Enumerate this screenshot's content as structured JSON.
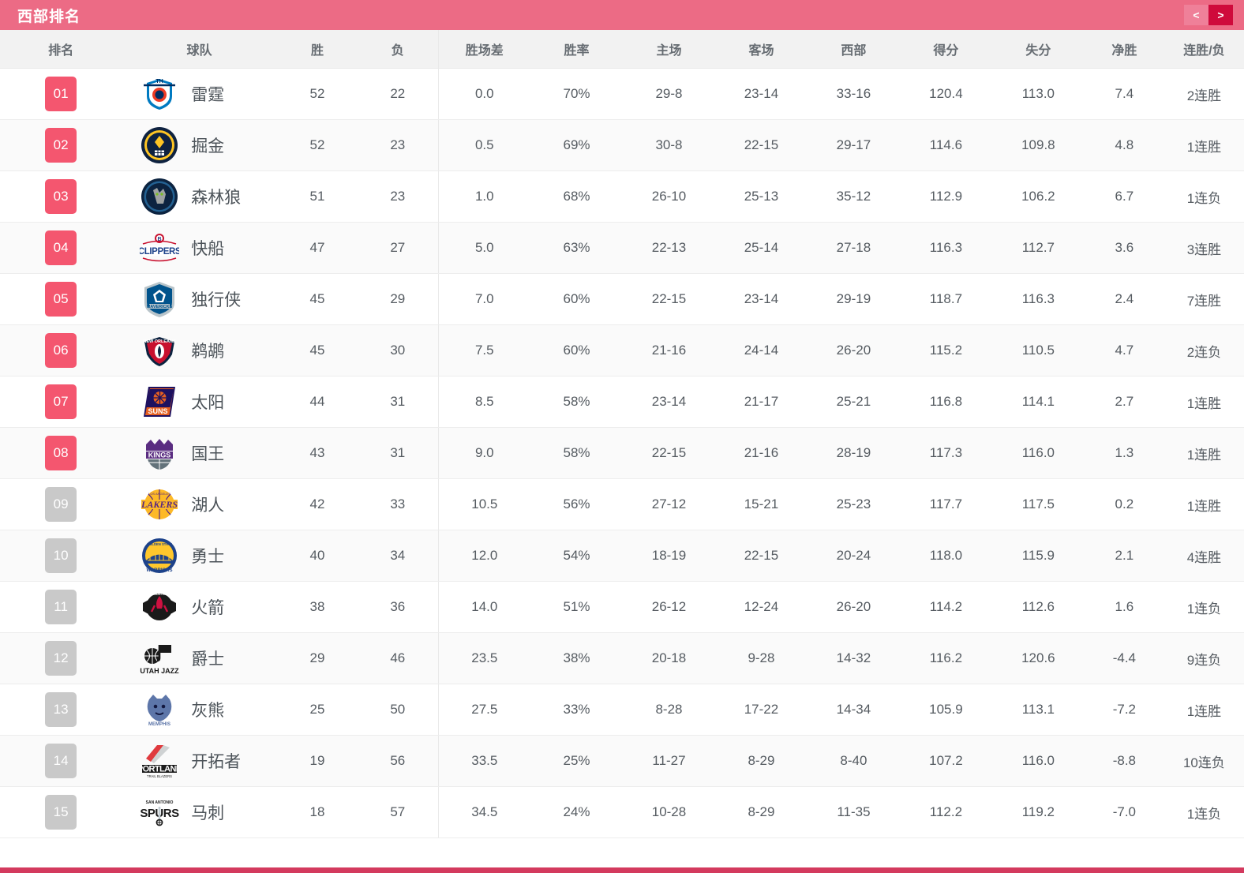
{
  "header": {
    "title": "西部排名",
    "prev_label": "<",
    "next_label": ">"
  },
  "table": {
    "columns": [
      "排名",
      "球队",
      "胜",
      "负",
      "胜场差",
      "胜率",
      "主场",
      "客场",
      "西部",
      "得分",
      "失分",
      "净胜",
      "连胜/负"
    ],
    "rows": [
      {
        "rank": "01",
        "playoff": true,
        "team": "雷霆",
        "logo": "thunder",
        "w": "52",
        "l": "22",
        "gb": "0.0",
        "pct": "70%",
        "home": "29-8",
        "away": "23-14",
        "conf": "33-16",
        "pf": "120.4",
        "pa": "113.0",
        "diff": "7.4",
        "streak": "2连胜"
      },
      {
        "rank": "02",
        "playoff": true,
        "team": "掘金",
        "logo": "nuggets",
        "w": "52",
        "l": "23",
        "gb": "0.5",
        "pct": "69%",
        "home": "30-8",
        "away": "22-15",
        "conf": "29-17",
        "pf": "114.6",
        "pa": "109.8",
        "diff": "4.8",
        "streak": "1连胜"
      },
      {
        "rank": "03",
        "playoff": true,
        "team": "森林狼",
        "logo": "timberwolves",
        "w": "51",
        "l": "23",
        "gb": "1.0",
        "pct": "68%",
        "home": "26-10",
        "away": "25-13",
        "conf": "35-12",
        "pf": "112.9",
        "pa": "106.2",
        "diff": "6.7",
        "streak": "1连负"
      },
      {
        "rank": "04",
        "playoff": true,
        "team": "快船",
        "logo": "clippers",
        "w": "47",
        "l": "27",
        "gb": "5.0",
        "pct": "63%",
        "home": "22-13",
        "away": "25-14",
        "conf": "27-18",
        "pf": "116.3",
        "pa": "112.7",
        "diff": "3.6",
        "streak": "3连胜"
      },
      {
        "rank": "05",
        "playoff": true,
        "team": "独行侠",
        "logo": "mavericks",
        "w": "45",
        "l": "29",
        "gb": "7.0",
        "pct": "60%",
        "home": "22-15",
        "away": "23-14",
        "conf": "29-19",
        "pf": "118.7",
        "pa": "116.3",
        "diff": "2.4",
        "streak": "7连胜"
      },
      {
        "rank": "06",
        "playoff": true,
        "team": "鹈鹕",
        "logo": "pelicans",
        "w": "45",
        "l": "30",
        "gb": "7.5",
        "pct": "60%",
        "home": "21-16",
        "away": "24-14",
        "conf": "26-20",
        "pf": "115.2",
        "pa": "110.5",
        "diff": "4.7",
        "streak": "2连负"
      },
      {
        "rank": "07",
        "playoff": true,
        "team": "太阳",
        "logo": "suns",
        "w": "44",
        "l": "31",
        "gb": "8.5",
        "pct": "58%",
        "home": "23-14",
        "away": "21-17",
        "conf": "25-21",
        "pf": "116.8",
        "pa": "114.1",
        "diff": "2.7",
        "streak": "1连胜"
      },
      {
        "rank": "08",
        "playoff": true,
        "team": "国王",
        "logo": "kings",
        "w": "43",
        "l": "31",
        "gb": "9.0",
        "pct": "58%",
        "home": "22-15",
        "away": "21-16",
        "conf": "28-19",
        "pf": "117.3",
        "pa": "116.0",
        "diff": "1.3",
        "streak": "1连胜"
      },
      {
        "rank": "09",
        "playoff": false,
        "team": "湖人",
        "logo": "lakers",
        "w": "42",
        "l": "33",
        "gb": "10.5",
        "pct": "56%",
        "home": "27-12",
        "away": "15-21",
        "conf": "25-23",
        "pf": "117.7",
        "pa": "117.5",
        "diff": "0.2",
        "streak": "1连胜"
      },
      {
        "rank": "10",
        "playoff": false,
        "team": "勇士",
        "logo": "warriors",
        "w": "40",
        "l": "34",
        "gb": "12.0",
        "pct": "54%",
        "home": "18-19",
        "away": "22-15",
        "conf": "20-24",
        "pf": "118.0",
        "pa": "115.9",
        "diff": "2.1",
        "streak": "4连胜"
      },
      {
        "rank": "11",
        "playoff": false,
        "team": "火箭",
        "logo": "rockets",
        "w": "38",
        "l": "36",
        "gb": "14.0",
        "pct": "51%",
        "home": "26-12",
        "away": "12-24",
        "conf": "26-20",
        "pf": "114.2",
        "pa": "112.6",
        "diff": "1.6",
        "streak": "1连负"
      },
      {
        "rank": "12",
        "playoff": false,
        "team": "爵士",
        "logo": "jazz",
        "w": "29",
        "l": "46",
        "gb": "23.5",
        "pct": "38%",
        "home": "20-18",
        "away": "9-28",
        "conf": "14-32",
        "pf": "116.2",
        "pa": "120.6",
        "diff": "-4.4",
        "streak": "9连负"
      },
      {
        "rank": "13",
        "playoff": false,
        "team": "灰熊",
        "logo": "grizzlies",
        "w": "25",
        "l": "50",
        "gb": "27.5",
        "pct": "33%",
        "home": "8-28",
        "away": "17-22",
        "conf": "14-34",
        "pf": "105.9",
        "pa": "113.1",
        "diff": "-7.2",
        "streak": "1连胜"
      },
      {
        "rank": "14",
        "playoff": false,
        "team": "开拓者",
        "logo": "blazers",
        "w": "19",
        "l": "56",
        "gb": "33.5",
        "pct": "25%",
        "home": "11-27",
        "away": "8-29",
        "conf": "8-40",
        "pf": "107.2",
        "pa": "116.0",
        "diff": "-8.8",
        "streak": "10连负"
      },
      {
        "rank": "15",
        "playoff": false,
        "team": "马刺",
        "logo": "spurs",
        "w": "18",
        "l": "57",
        "gb": "34.5",
        "pct": "24%",
        "home": "10-28",
        "away": "8-29",
        "conf": "11-35",
        "pf": "112.2",
        "pa": "119.2",
        "diff": "-7.0",
        "streak": "1连负"
      }
    ]
  },
  "colors": {
    "header_pink": "#ec6b85",
    "badge_playoff": "#f4566f",
    "badge_out": "#c9c9c9",
    "nav_prev": "#ef8099",
    "nav_next": "#cf0a3b",
    "bottom_bar": "#d33a5e"
  }
}
